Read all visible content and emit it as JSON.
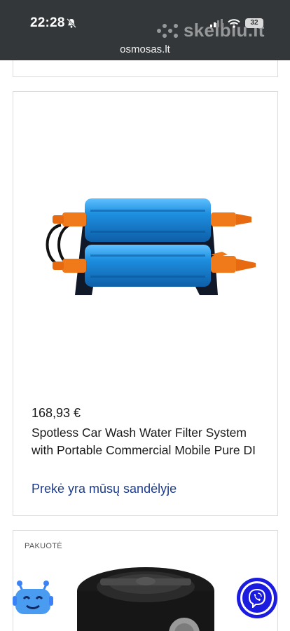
{
  "status_bar": {
    "time": "22:28",
    "battery": "32",
    "url": "osmosas.lt",
    "watermark": "skelbiu.lt"
  },
  "product": {
    "price": "168,93 €",
    "title": "Spotless Car Wash Water Filter System with Portable Commercial Mobile Pure DI",
    "stock": "Prekė yra mūsų sandėlyje",
    "image_icon": "water-filter-image"
  },
  "next_product": {
    "label": "PAKUOTĖ"
  },
  "floating": {
    "bot_icon": "chatbot-icon",
    "viber_icon": "viber-icon"
  },
  "colors": {
    "status_bg": "#333739",
    "link_blue": "#1b3b8f",
    "viber_blue": "#1c1ce0",
    "filter_blue": "#1e8fe0",
    "fitting_orange": "#f07a1a"
  }
}
